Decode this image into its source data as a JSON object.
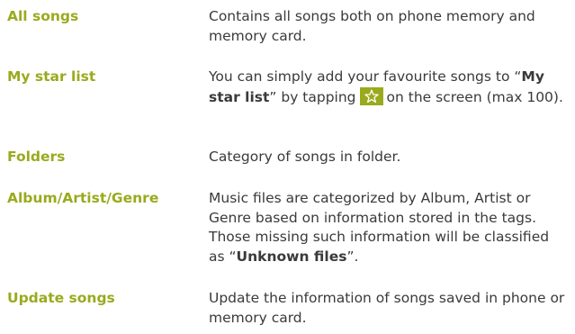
{
  "entries": [
    {
      "term": "All songs",
      "definition": "Contains all songs both on phone memory and memory card."
    },
    {
      "term": "My star list",
      "definition_part1": "You can simply add your favourite songs to “",
      "definition_bold1": "My star list",
      "definition_part2": "” by tapping",
      "star_icon": "star-icon",
      "definition_part3": "on the screen (max 100)."
    },
    {
      "term": "Folders",
      "definition": "Category of songs in folder."
    },
    {
      "term": "Album/Artist/Genre",
      "definition_part1": "Music files are categorized by Album, Artist or Genre based on information stored in the tags. Those missing such information will be classified as “",
      "definition_bold1": "Unknown files",
      "definition_part2": "”."
    },
    {
      "term": "Update songs",
      "definition": "Update the information of songs saved in phone or memory card."
    }
  ],
  "colors": {
    "accent": "#9aaa1e",
    "text": "#3a3a3a"
  }
}
